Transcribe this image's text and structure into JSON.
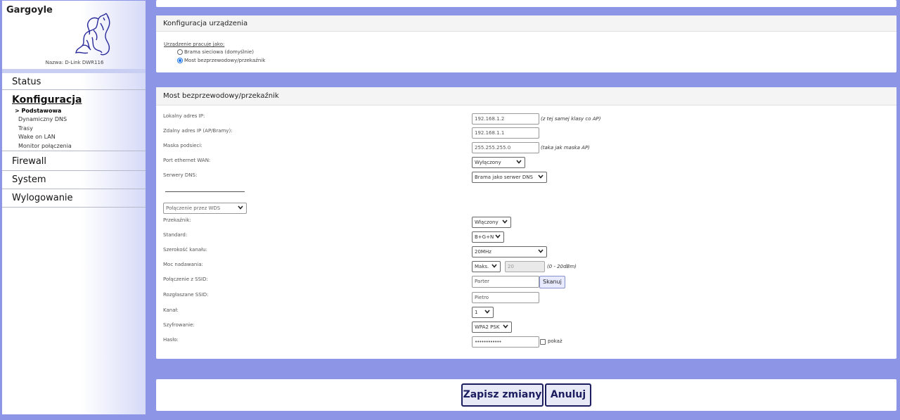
{
  "app": {
    "brand": "Gargoyle",
    "device_name": "Nazwa: D-Link DWR116"
  },
  "nav": {
    "status": "Status",
    "konfiguracja": "Konfiguracja",
    "sub": [
      "> Podstawowa",
      "Dynamiczny DNS",
      "Trasy",
      "Wake on LAN",
      "Monitor połączenia"
    ],
    "firewall": "Firewall",
    "system": "System",
    "logout": "Wylogowanie"
  },
  "device": {
    "title": "Konfiguracja urządzenia",
    "mode_label": "Urządzenie pracuje jako:",
    "options": [
      "Brama sieciowa (domyślnie)",
      "Most bezprzewodowy/przekaźnik"
    ],
    "selected": "Most bezprzewodowy/przekaźnik"
  },
  "bridge": {
    "title": "Most bezprzewodowy/przekaźnik",
    "labels": {
      "local_ip": "Lokalny adres IP:",
      "remote_ip": "Zdalny adres IP (AP/Bramy):",
      "mask": "Maska podsieci:",
      "wan_port": "Port ethernet WAN:",
      "dns": "Serwery DNS:",
      "relay": "Przekaźnik:",
      "standard": "Standard:",
      "channel_width": "Szerokość kanału:",
      "tx_power": "Moc nadawania:",
      "ssid_conn": "Połączenie z SSID:",
      "ssid_broadcast": "Rozgłaszane SSID:",
      "channel": "Kanał:",
      "encryption": "Szyfrowanie:",
      "password": "Hasło:"
    },
    "values": {
      "local_ip": "192.168.1.2",
      "remote_ip": "192.168.1.1",
      "mask": "255.255.255.0",
      "wan_port": "Wyłączony",
      "dns": "Brama jako serwer DNS",
      "wds": "Połączenie przez WDS",
      "relay": "Włączony",
      "standard": "B+G+N",
      "channel_width": "20MHz",
      "tx_power_mode": "Maks.",
      "tx_power_value": "20",
      "ssid_conn": "Parter",
      "ssid_broadcast": "Pietro",
      "channel": "1",
      "encryption": "WPA2 PSK",
      "password": "••••••••••••"
    },
    "hints": {
      "local_ip": "(z tej samej klasy co AP)",
      "mask": "(taka jak maska AP)",
      "tx_power": "(0 - 20dBm)"
    },
    "scan_label": "Skanuj",
    "show_label": "pokaż"
  },
  "actions": {
    "save": "Zapisz zmiany",
    "cancel": "Anuluj"
  }
}
